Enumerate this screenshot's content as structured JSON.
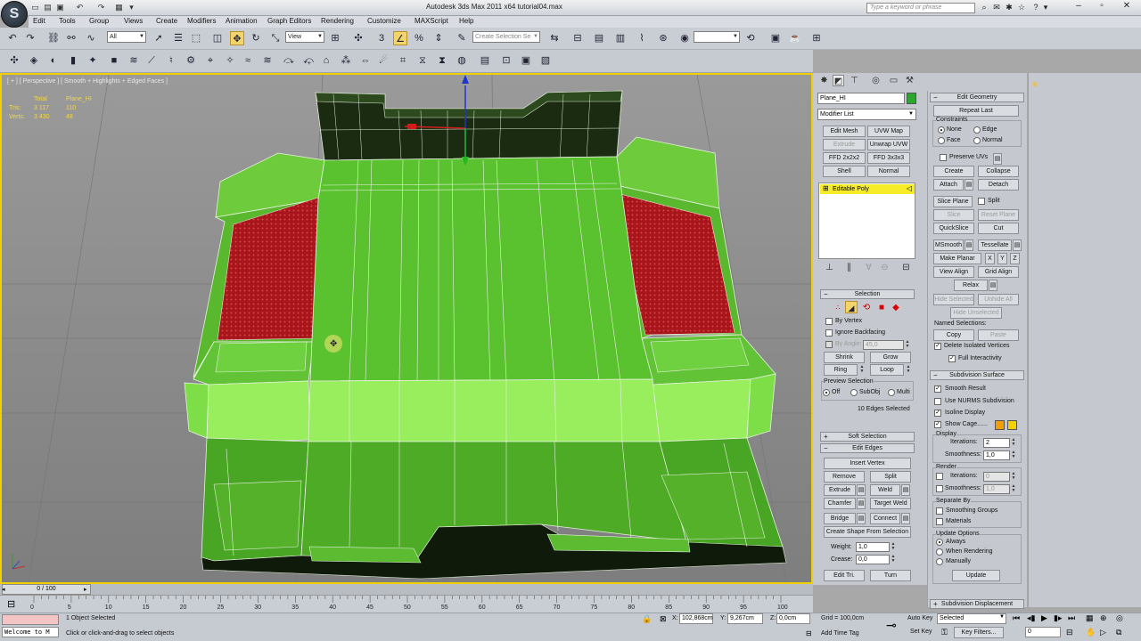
{
  "window": {
    "title": "Autodesk 3ds Max  2011 x64        tutorial04.max",
    "search_placeholder": "Type a keyword or phrase"
  },
  "menu": [
    "Edit",
    "Tools",
    "Group",
    "Views",
    "Create",
    "Modifiers",
    "Animation",
    "Graph Editors",
    "Rendering",
    "Customize",
    "MAXScript",
    "Help"
  ],
  "toolbar": {
    "filter_value": "All",
    "refcoord_value": "View",
    "named_selection_placeholder": "Create Selection Se"
  },
  "viewport": {
    "label": "[ + ] [ Perspective ] [ Smooth + Highlights + Edged Faces ]",
    "stats": {
      "header_total": "Total",
      "header_object": "Plane_HI",
      "tris_label": "Tris:",
      "tris_total": "3 117",
      "tris_object": "110",
      "verts_label": "Verts:",
      "verts_total": "3 430",
      "verts_object": "48"
    }
  },
  "command_panel": {
    "object_name": "Plane_HI",
    "object_color": "#2ea52e",
    "modifier_list": "Modifier List",
    "mod_buttons": [
      "Edit Mesh",
      "UVW Map",
      "Extrude",
      "Unwrap UVW",
      "FFD 2x2x2",
      "FFD 3x3x3",
      "Shell",
      "Normal"
    ],
    "stack_item": "Editable Poly",
    "selection": {
      "title": "Selection",
      "by_vertex": "By Vertex",
      "ignore_backfacing": "Ignore Backfacing",
      "by_angle": "By Angle:",
      "by_angle_value": "45,0",
      "shrink": "Shrink",
      "grow": "Grow",
      "ring": "Ring",
      "loop": "Loop",
      "preview_title": "Preview Selection",
      "preview_off": "Off",
      "preview_subobj": "SubObj",
      "preview_multi": "Multi",
      "status": "10 Edges Selected"
    },
    "soft_selection": "Soft Selection",
    "edit_edges": {
      "title": "Edit Edges",
      "insert_vertex": "Insert Vertex",
      "remove": "Remove",
      "split": "Split",
      "extrude": "Extrude",
      "weld": "Weld",
      "chamfer": "Chamfer",
      "target_weld": "Target Weld",
      "bridge": "Bridge",
      "connect": "Connect",
      "create_shape": "Create Shape From Selection",
      "weight_label": "Weight:",
      "weight_value": "1,0",
      "crease_label": "Crease:",
      "crease_value": "0,0",
      "edit_tri": "Edit Tri.",
      "turn": "Turn"
    }
  },
  "edit_geometry": {
    "title": "Edit Geometry",
    "repeat_last": "Repeat Last",
    "constraints": "Constraints",
    "none": "None",
    "edge": "Edge",
    "face": "Face",
    "normal": "Normal",
    "preserve_uvs": "Preserve UVs",
    "create": "Create",
    "collapse": "Collapse",
    "attach": "Attach",
    "detach": "Detach",
    "slice_plane": "Slice Plane",
    "split": "Split",
    "slice": "Slice",
    "reset_plane": "Reset Plane",
    "quickslice": "QuickSlice",
    "cut": "Cut",
    "msmooth": "MSmooth",
    "tessellate": "Tessellate",
    "make_planar": "Make Planar",
    "x": "X",
    "y": "Y",
    "z": "Z",
    "view_align": "View Align",
    "grid_align": "Grid Align",
    "relax": "Relax",
    "hide_selected": "Hide Selected",
    "unhide_all": "Unhide All",
    "hide_unselected": "Hide Unselected",
    "named_selections": "Named Selections:",
    "copy": "Copy",
    "paste": "Paste",
    "delete_isolated": "Delete Isolated Vertices",
    "full_interactivity": "Full Interactivity"
  },
  "subdivision": {
    "title": "Subdivision Surface",
    "smooth_result": "Smooth Result",
    "use_nurms": "Use NURMS Subdivision",
    "isoline": "Isoline Display",
    "show_cage": "Show Cage......",
    "cage_color_1": "#f0a000",
    "cage_color_2": "#f5d000",
    "display": "Display",
    "iterations_label": "Iterations:",
    "iterations_value": "2",
    "smoothness_label": "Smoothness:",
    "smoothness_value": "1,0",
    "render": "Render",
    "r_iterations_value": "0",
    "r_smoothness_value": "1,0",
    "separate_by": "Separate By",
    "smoothing_groups": "Smoothing Groups",
    "materials": "Materials",
    "update_options": "Update Options",
    "always": "Always",
    "when_rendering": "When Rendering",
    "manually": "Manually",
    "update": "Update",
    "displacement": "Subdivision Displacement"
  },
  "timeline": {
    "slider": "0 / 100",
    "ticks": [
      "0",
      "5",
      "10",
      "15",
      "20",
      "25",
      "30",
      "35",
      "40",
      "45",
      "50",
      "55",
      "60",
      "65",
      "70",
      "75",
      "80",
      "85",
      "90",
      "95",
      "100"
    ]
  },
  "status": {
    "maxscript": "Welcome to M",
    "selection": "1 Object Selected",
    "prompt": "Click or click-and-drag to select objects",
    "x_label": "X:",
    "x_value": "102,868cm",
    "y_label": "Y:",
    "y_value": "9,267cm",
    "z_label": "Z:",
    "z_value": "0,0cm",
    "grid": "Grid = 100,0cm",
    "add_time_tag": "Add Time Tag",
    "auto_key": "Auto Key",
    "set_key": "Set Key",
    "key_mode": "Selected",
    "key_filters": "Key Filters...",
    "frame": "0"
  }
}
